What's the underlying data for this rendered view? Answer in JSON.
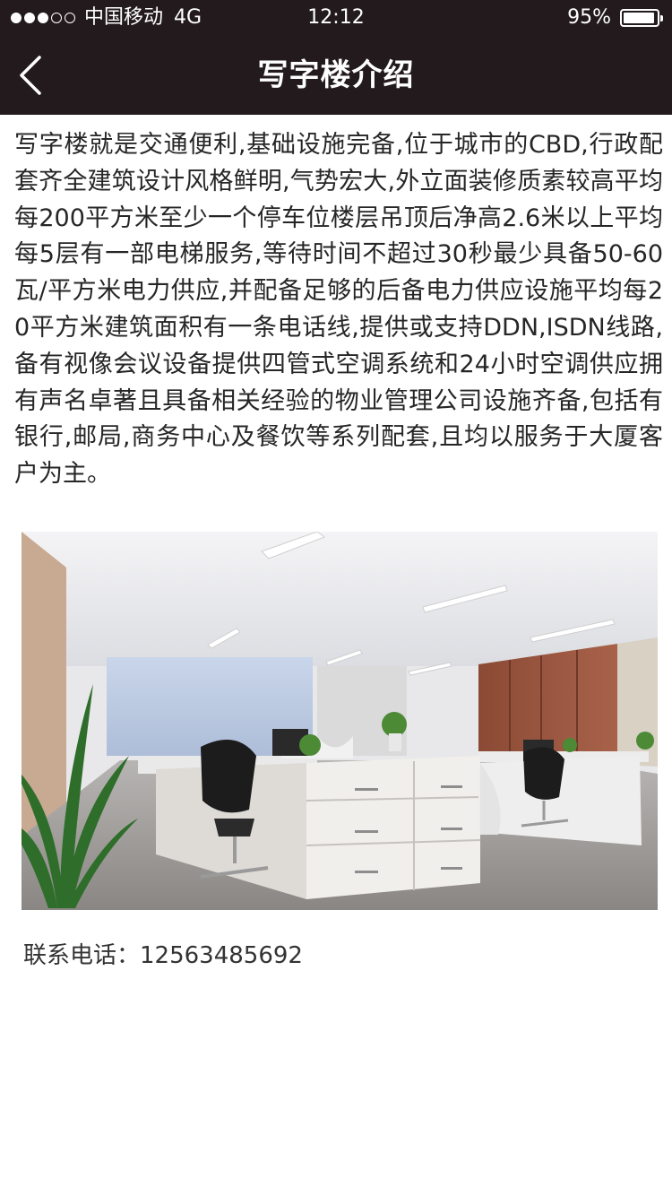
{
  "status_bar": {
    "carrier": "中国移动",
    "network": "4G",
    "time": "12:12",
    "battery": "95%",
    "battery_level": 0.95,
    "signal_bars_filled": 3,
    "signal_bars_total": 5
  },
  "header": {
    "title": "写字楼介绍",
    "back_icon": "chevron-left-icon",
    "background": "#231a1d"
  },
  "content": {
    "intro": "写字楼就是交通便利,基础设施完备,位于城市的CBD,行政配套齐全建筑设计风格鲜明,气势宏大,外立面装修质素较高平均每200平方米至少一个停车位楼层吊顶后净高2.6米以上平均每5层有一部电梯服务,等待时间不超过30秒最少具备50-60瓦/平方米电力供应,并配备足够的后备电力供应设施平均每20平方米建筑面积有一条电话线,提供或支持DDN,ISDN线路,备有视像会议设备提供四管式空调系统和24小时空调供应拥有声名卓著且具备相关经验的物业管理公司设施齐备,包括有银行,邮局,商务中心及餐饮等系列配套,且均以服务于大厦客户为主。",
    "contact": "联系电话：12563485692"
  }
}
